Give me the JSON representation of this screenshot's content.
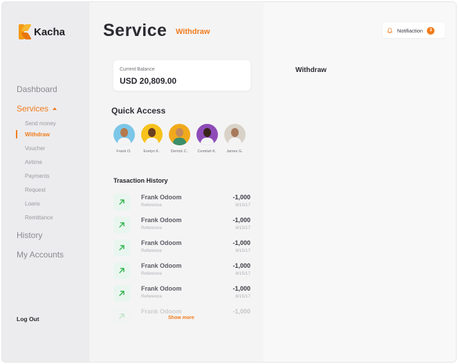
{
  "app": {
    "name": "Kacha"
  },
  "colors": {
    "accent": "#f07b1c",
    "positive": "#2db34a"
  },
  "sidebar": {
    "dashboard": "Dashboard",
    "services": "Services",
    "sub_items": [
      "Send money",
      "Withdraw",
      "Voucher",
      "Airtime",
      "Payments",
      "Request",
      "Loans",
      "Remittance"
    ],
    "active_sub": "Withdraw",
    "history": "History",
    "my_accounts": "My Accounts",
    "logout": "Log Out"
  },
  "header": {
    "title": "Service",
    "subtitle": "Withdraw"
  },
  "balance": {
    "label": "Current Balance",
    "value": "USD  20,809.00"
  },
  "quick_access": {
    "title": "Quick Access",
    "contacts": [
      {
        "name": "Frank O.",
        "bg": "#7cc6e8",
        "skin": "#b57a4e",
        "shirt": "#f4f4f4"
      },
      {
        "name": "Evelyn K.",
        "bg": "#f6c21b",
        "skin": "#6b3f22",
        "shirt": "#f4f4f4"
      },
      {
        "name": "Derrick C.",
        "bg": "#f1a91c",
        "skin": "#c48a5b",
        "shirt": "#3b8f6a"
      },
      {
        "name": "Cemilah K.",
        "bg": "#8e4cb8",
        "skin": "#3a2418",
        "shirt": "#f4f4f4"
      },
      {
        "name": "James G.",
        "bg": "#d9d2c8",
        "skin": "#a77a5c",
        "shirt": "#f4f4f4"
      }
    ]
  },
  "transactions": {
    "title": "Trasaction History",
    "items": [
      {
        "name": "Frank Odoom",
        "ref": "Reference",
        "amount": "-1,000",
        "date": "8/15/17"
      },
      {
        "name": "Frank Odoom",
        "ref": "Reference",
        "amount": "-1,000",
        "date": "8/15/17"
      },
      {
        "name": "Frank Odoom",
        "ref": "Reference",
        "amount": "-1,000",
        "date": "8/15/17"
      },
      {
        "name": "Frank Odoom",
        "ref": "Reference",
        "amount": "-1,000",
        "date": "8/15/17"
      },
      {
        "name": "Frank Odoom",
        "ref": "Reference",
        "amount": "-1,000",
        "date": "8/15/17"
      },
      {
        "name": "Frank Odoom",
        "ref": "",
        "amount": "-1,000",
        "date": ""
      }
    ],
    "show_more": "Show more"
  },
  "panel": {
    "title": "Withdraw"
  },
  "notification": {
    "label": "Notifiaction",
    "count": "3",
    "icon": "bell-icon"
  }
}
